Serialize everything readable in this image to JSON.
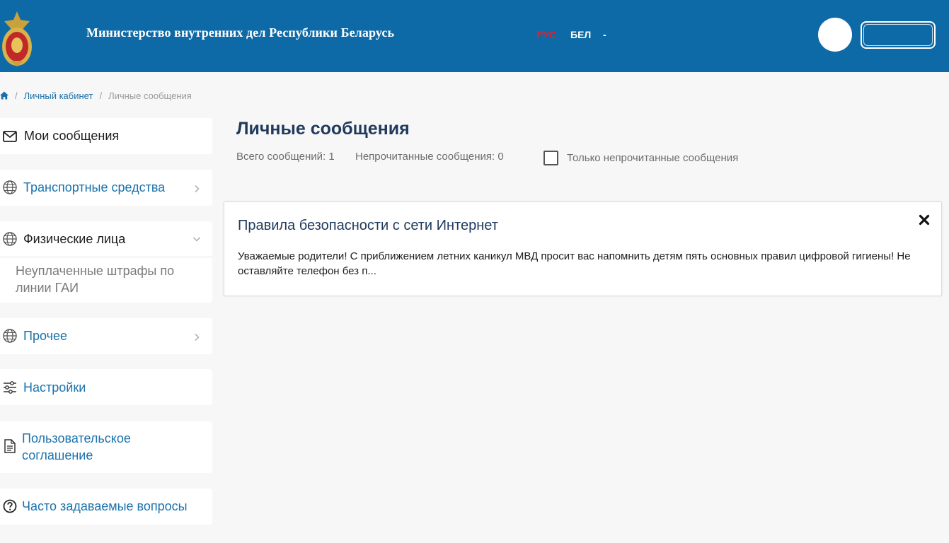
{
  "header": {
    "site_title": "Министерство внутренних дел Республики Беларусь",
    "lang_rus": "РУС",
    "lang_bel": "БЕЛ",
    "lang_dash": "-"
  },
  "breadcrumb": {
    "link": "Личный кабинет",
    "current": "Личные сообщения",
    "separator": "/"
  },
  "sidebar": {
    "items": [
      {
        "label": "Мои сообщения",
        "icon": "envelope-icon"
      },
      {
        "label": "Транспортные средства",
        "icon": "globe-icon"
      },
      {
        "label": "Физические лица",
        "icon": "globe-icon",
        "sub_line1": "Неуплаченные штрафы по",
        "sub_line2": "линии ГАИ"
      },
      {
        "label": "Прочее",
        "icon": "globe-icon"
      },
      {
        "label": "Настройки",
        "icon": "sliders-icon"
      },
      {
        "label_line1": "Пользовательское",
        "label_line2": "соглашение",
        "icon": "document-icon"
      },
      {
        "label": "Часто задаваемые вопросы",
        "icon": "question-circle-icon"
      }
    ]
  },
  "main": {
    "title": "Личные сообщения",
    "total": "Всего сообщений: 1",
    "unread": "Непрочитанные сообщения: 0",
    "only_unread_label": "Только непрочитанные сообщения",
    "messages": [
      {
        "title": "Правила безопасности с сети Интернет",
        "body": "Уважаемые родители! С приближением летних каникул МВД просит вас напомнить детям пять основных правил цифровой гигиены! Не оставляйте телефон без п..."
      }
    ]
  },
  "colors": {
    "header_bg": "#0e6aa6",
    "accent_red": "#e0202c",
    "link_blue": "#1a72ac"
  }
}
